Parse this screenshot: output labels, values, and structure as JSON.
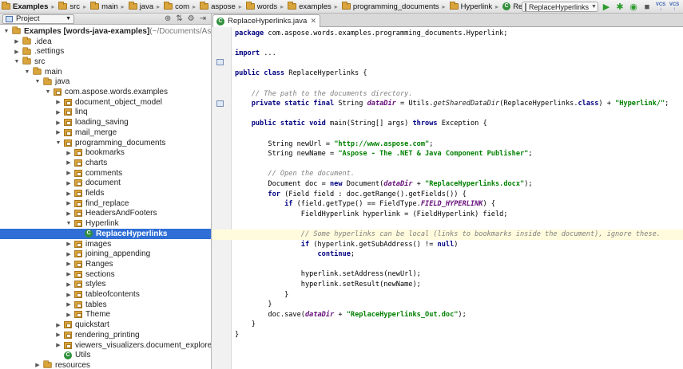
{
  "breadcrumbs": [
    "Examples",
    "src",
    "main",
    "java",
    "com",
    "aspose",
    "words",
    "examples",
    "programming_documents",
    "Hyperlink",
    "ReplaceHyperlinks"
  ],
  "run_config": {
    "label": "ReplaceHyperlinks"
  },
  "vcs_labels": [
    "VCS",
    "VCS"
  ],
  "project_panel": {
    "view_label": "Project",
    "tree": [
      {
        "label": "Examples [words-java-examples]",
        "suffix": " (~/Documents/Aspo",
        "indent": 0,
        "arrow": "▼",
        "icon": "folder",
        "bold": true
      },
      {
        "label": ".idea",
        "indent": 1,
        "arrow": "▶",
        "icon": "folder"
      },
      {
        "label": ".settings",
        "indent": 1,
        "arrow": "▶",
        "icon": "folder"
      },
      {
        "label": "src",
        "indent": 1,
        "arrow": "▼",
        "icon": "folder"
      },
      {
        "label": "main",
        "indent": 2,
        "arrow": "▼",
        "icon": "folder"
      },
      {
        "label": "java",
        "indent": 3,
        "arrow": "▼",
        "icon": "folder"
      },
      {
        "label": "com.aspose.words.examples",
        "indent": 4,
        "arrow": "▼",
        "icon": "package"
      },
      {
        "label": "document_object_model",
        "indent": 5,
        "arrow": "▶",
        "icon": "package"
      },
      {
        "label": "linq",
        "indent": 5,
        "arrow": "▶",
        "icon": "package"
      },
      {
        "label": "loading_saving",
        "indent": 5,
        "arrow": "▶",
        "icon": "package"
      },
      {
        "label": "mail_merge",
        "indent": 5,
        "arrow": "▶",
        "icon": "package"
      },
      {
        "label": "programming_documents",
        "indent": 5,
        "arrow": "▼",
        "icon": "package"
      },
      {
        "label": "bookmarks",
        "indent": 6,
        "arrow": "▶",
        "icon": "package"
      },
      {
        "label": "charts",
        "indent": 6,
        "arrow": "▶",
        "icon": "package"
      },
      {
        "label": "comments",
        "indent": 6,
        "arrow": "▶",
        "icon": "package"
      },
      {
        "label": "document",
        "indent": 6,
        "arrow": "▶",
        "icon": "package"
      },
      {
        "label": "fields",
        "indent": 6,
        "arrow": "▶",
        "icon": "package"
      },
      {
        "label": "find_replace",
        "indent": 6,
        "arrow": "▶",
        "icon": "package"
      },
      {
        "label": "HeadersAndFooters",
        "indent": 6,
        "arrow": "▶",
        "icon": "package"
      },
      {
        "label": "Hyperlink",
        "indent": 6,
        "arrow": "▼",
        "icon": "package"
      },
      {
        "label": "ReplaceHyperlinks",
        "indent": 7,
        "arrow": "",
        "icon": "class",
        "selected": true
      },
      {
        "label": "images",
        "indent": 6,
        "arrow": "▶",
        "icon": "package"
      },
      {
        "label": "joining_appending",
        "indent": 6,
        "arrow": "▶",
        "icon": "package"
      },
      {
        "label": "Ranges",
        "indent": 6,
        "arrow": "▶",
        "icon": "package"
      },
      {
        "label": "sections",
        "indent": 6,
        "arrow": "▶",
        "icon": "package"
      },
      {
        "label": "styles",
        "indent": 6,
        "arrow": "▶",
        "icon": "package"
      },
      {
        "label": "tableofcontents",
        "indent": 6,
        "arrow": "▶",
        "icon": "package"
      },
      {
        "label": "tables",
        "indent": 6,
        "arrow": "▶",
        "icon": "package"
      },
      {
        "label": "Theme",
        "indent": 6,
        "arrow": "▶",
        "icon": "package"
      },
      {
        "label": "quickstart",
        "indent": 5,
        "arrow": "▶",
        "icon": "package"
      },
      {
        "label": "rendering_printing",
        "indent": 5,
        "arrow": "▶",
        "icon": "package"
      },
      {
        "label": "viewers_visualizers.document_explorer",
        "indent": 5,
        "arrow": "▶",
        "icon": "package"
      },
      {
        "label": "Utils",
        "indent": 5,
        "arrow": "",
        "icon": "class"
      },
      {
        "label": "resources",
        "indent": 3,
        "arrow": "▶",
        "icon": "folder"
      }
    ]
  },
  "editor": {
    "tab_label": "ReplaceHyperlinks.java",
    "code_lines": [
      {
        "row": 0,
        "tokens": [
          [
            "kw",
            "package"
          ],
          [
            "pln",
            " com.aspose.words.examples.programming_documents.Hyperlink;"
          ]
        ]
      },
      {
        "row": 2,
        "tokens": [
          [
            "kw",
            "import"
          ],
          [
            "pln",
            " ..."
          ]
        ]
      },
      {
        "row": 4,
        "tokens": [
          [
            "kw",
            "public class"
          ],
          [
            "pln",
            " ReplaceHyperlinks {"
          ]
        ]
      },
      {
        "row": 6,
        "tokens": [
          [
            "pln",
            "    "
          ],
          [
            "cmt",
            "// The path to the documents directory."
          ]
        ]
      },
      {
        "row": 7,
        "tokens": [
          [
            "pln",
            "    "
          ],
          [
            "kw",
            "private static final"
          ],
          [
            "pln",
            " String "
          ],
          [
            "fld",
            "dataDir"
          ],
          [
            "pln",
            " = Utils."
          ],
          [
            "st",
            "getSharedDataDir"
          ],
          [
            "pln",
            "(ReplaceHyperlinks."
          ],
          [
            "kw",
            "class"
          ],
          [
            "pln",
            ") + "
          ],
          [
            "str",
            "\"Hyperlink/\""
          ],
          [
            "pln",
            ";"
          ]
        ]
      },
      {
        "row": 9,
        "tokens": [
          [
            "pln",
            "    "
          ],
          [
            "kw",
            "public static void"
          ],
          [
            "pln",
            " main(String[] args) "
          ],
          [
            "kw",
            "throws"
          ],
          [
            "pln",
            " Exception {"
          ]
        ]
      },
      {
        "row": 11,
        "tokens": [
          [
            "pln",
            "        String newUrl = "
          ],
          [
            "str",
            "\"http://www.aspose.com\""
          ],
          [
            "pln",
            ";"
          ]
        ]
      },
      {
        "row": 12,
        "tokens": [
          [
            "pln",
            "        String newName = "
          ],
          [
            "str",
            "\"Aspose - The .NET & Java Component Publisher\""
          ],
          [
            "pln",
            ";"
          ]
        ]
      },
      {
        "row": 14,
        "tokens": [
          [
            "pln",
            "        "
          ],
          [
            "cmt",
            "// Open the document."
          ]
        ]
      },
      {
        "row": 15,
        "tokens": [
          [
            "pln",
            "        Document doc = "
          ],
          [
            "kw",
            "new"
          ],
          [
            "pln",
            " Document("
          ],
          [
            "fld",
            "dataDir"
          ],
          [
            "pln",
            " + "
          ],
          [
            "str",
            "\"ReplaceHyperlinks.docx\""
          ],
          [
            "pln",
            ");"
          ]
        ]
      },
      {
        "row": 16,
        "tokens": [
          [
            "pln",
            "        "
          ],
          [
            "kw",
            "for"
          ],
          [
            "pln",
            " (Field field : doc.getRange().getFields()) {"
          ]
        ]
      },
      {
        "row": 17,
        "tokens": [
          [
            "pln",
            "            "
          ],
          [
            "kw",
            "if"
          ],
          [
            "pln",
            " (field.getType() == FieldType."
          ],
          [
            "fld",
            "FIELD_HYPERLINK"
          ],
          [
            "pln",
            ") {"
          ]
        ]
      },
      {
        "row": 18,
        "tokens": [
          [
            "pln",
            "                FieldHyperlink hyperlink = (FieldHyperlink) field;"
          ]
        ]
      },
      {
        "row": 20,
        "highlight": true,
        "tokens": [
          [
            "pln",
            "                "
          ],
          [
            "cmt",
            "// Some hyperlinks can be local (links to bookmarks inside the document), ignore these."
          ]
        ]
      },
      {
        "row": 21,
        "tokens": [
          [
            "pln",
            "                "
          ],
          [
            "kw",
            "if"
          ],
          [
            "pln",
            " (hyperlink.getSubAddress() != "
          ],
          [
            "kw",
            "null"
          ],
          [
            "pln",
            ")"
          ]
        ]
      },
      {
        "row": 22,
        "tokens": [
          [
            "pln",
            "                    "
          ],
          [
            "kw",
            "continue"
          ],
          [
            "pln",
            ";"
          ]
        ]
      },
      {
        "row": 24,
        "tokens": [
          [
            "pln",
            "                hyperlink.setAddress(newUrl);"
          ]
        ]
      },
      {
        "row": 25,
        "tokens": [
          [
            "pln",
            "                hyperlink.setResult(newName);"
          ]
        ]
      },
      {
        "row": 26,
        "tokens": [
          [
            "pln",
            "            }"
          ]
        ]
      },
      {
        "row": 27,
        "tokens": [
          [
            "pln",
            "        }"
          ]
        ]
      },
      {
        "row": 28,
        "tokens": [
          [
            "pln",
            "        doc.save("
          ],
          [
            "fld",
            "dataDir"
          ],
          [
            "pln",
            " + "
          ],
          [
            "str",
            "\"ReplaceHyperlinks_Out.doc\""
          ],
          [
            "pln",
            ");"
          ]
        ]
      },
      {
        "row": 29,
        "tokens": [
          [
            "pln",
            "    }"
          ]
        ]
      },
      {
        "row": 30,
        "tokens": [
          [
            "pln",
            "}"
          ]
        ]
      }
    ]
  },
  "icons": {
    "run": "run-icon",
    "debug": "debug-icon",
    "settings": "gear-icon",
    "collapse": "collapse-icon",
    "target": "target-icon"
  }
}
